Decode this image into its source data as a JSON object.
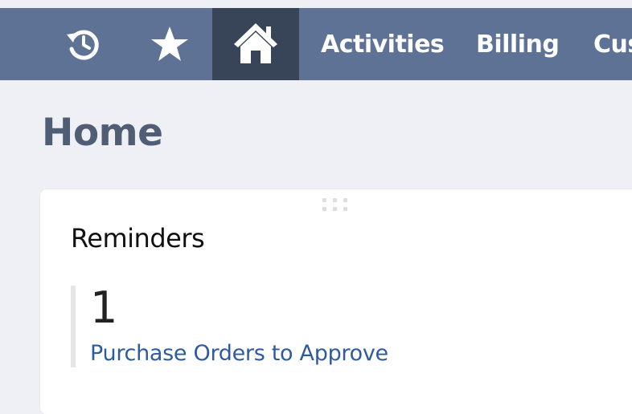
{
  "nav": {
    "icons": {
      "recent": "recent-history-icon",
      "favorites": "star-icon",
      "home": "home-icon"
    },
    "links": [
      "Activities",
      "Billing",
      "Cus"
    ]
  },
  "page": {
    "title": "Home"
  },
  "reminders": {
    "title": "Reminders",
    "items": [
      {
        "count": "1",
        "label": "Purchase Orders to Approve"
      }
    ]
  },
  "colors": {
    "navbar": "#5d7295",
    "navbar_active": "#384558",
    "page_bg": "#eff0f5",
    "title": "#4f5d75",
    "link": "#2f5b9e"
  }
}
